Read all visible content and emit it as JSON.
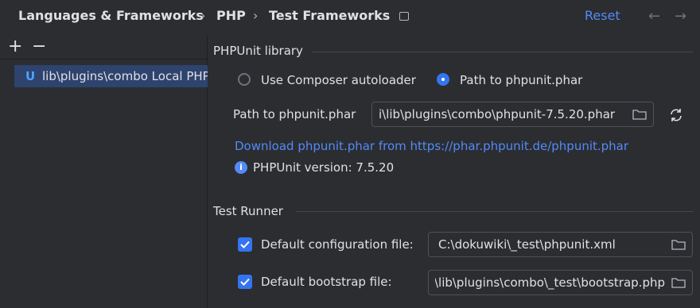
{
  "breadcrumb": [
    "Languages & Frameworks",
    "PHP",
    "Test Frameworks"
  ],
  "header": {
    "reset": "Reset",
    "back_icon": "←",
    "forward_icon": "→"
  },
  "tree": {
    "add_icon": "+",
    "remove_icon": "−",
    "item_icon": "U",
    "item_label": "lib\\plugins\\combo Local PHP"
  },
  "phpunit_library": {
    "title": "PHPUnit library",
    "options": [
      "Use Composer autoloader",
      "Path to phpunit.phar"
    ],
    "selected": "Path to phpunit.phar",
    "path_label": "Path to phpunit.phar",
    "path_value": "i\\lib\\plugins\\combo\\phpunit-7.5.20.phar",
    "download_link": "Download phpunit.phar from https://phar.phpunit.de/phpunit.phar",
    "info_icon": "i",
    "version": "PHPUnit version: 7.5.20"
  },
  "test_runner": {
    "title": "Test Runner",
    "config_label": "Default configuration file:",
    "config_checked": true,
    "config_value": "C:\\dokuwiki\\_test\\phpunit.xml",
    "bootstrap_label": "Default bootstrap file:",
    "bootstrap_checked": true,
    "bootstrap_value": "C:\\dokuwiki\\lib\\plugins\\combo\\_test\\bootstrap.php"
  },
  "colors": {
    "accent": "#548af7",
    "selection": "#2e436e",
    "background": "#2b2d30"
  }
}
